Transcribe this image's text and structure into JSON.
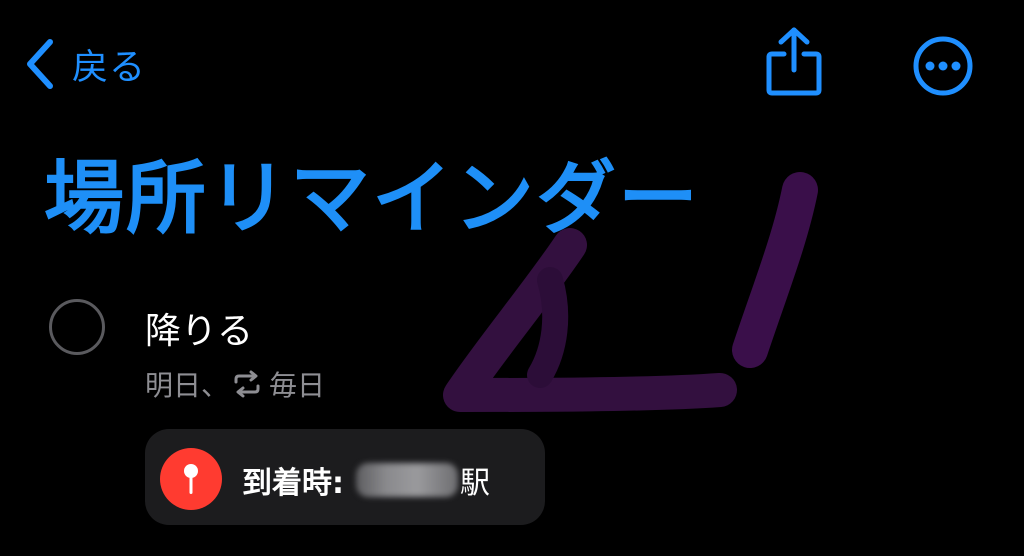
{
  "nav": {
    "back_label": "戻る"
  },
  "page": {
    "title": "場所リマインダー"
  },
  "reminder": {
    "title": "降りる",
    "date": "明日、",
    "repeat": "毎日",
    "location": {
      "prefix": "到着時:",
      "suffix": "駅"
    }
  },
  "colors": {
    "accent": "#1e8ff7",
    "pin": "#ff3b30",
    "chip_bg": "#1c1c1e",
    "secondary_text": "#8e8e93",
    "scribble": "#3a0f4a"
  },
  "icons": {
    "back": "chevron-left-icon",
    "share": "share-icon",
    "more": "ellipsis-circle-icon",
    "repeat": "repeat-icon",
    "pin": "map-pin-icon"
  }
}
